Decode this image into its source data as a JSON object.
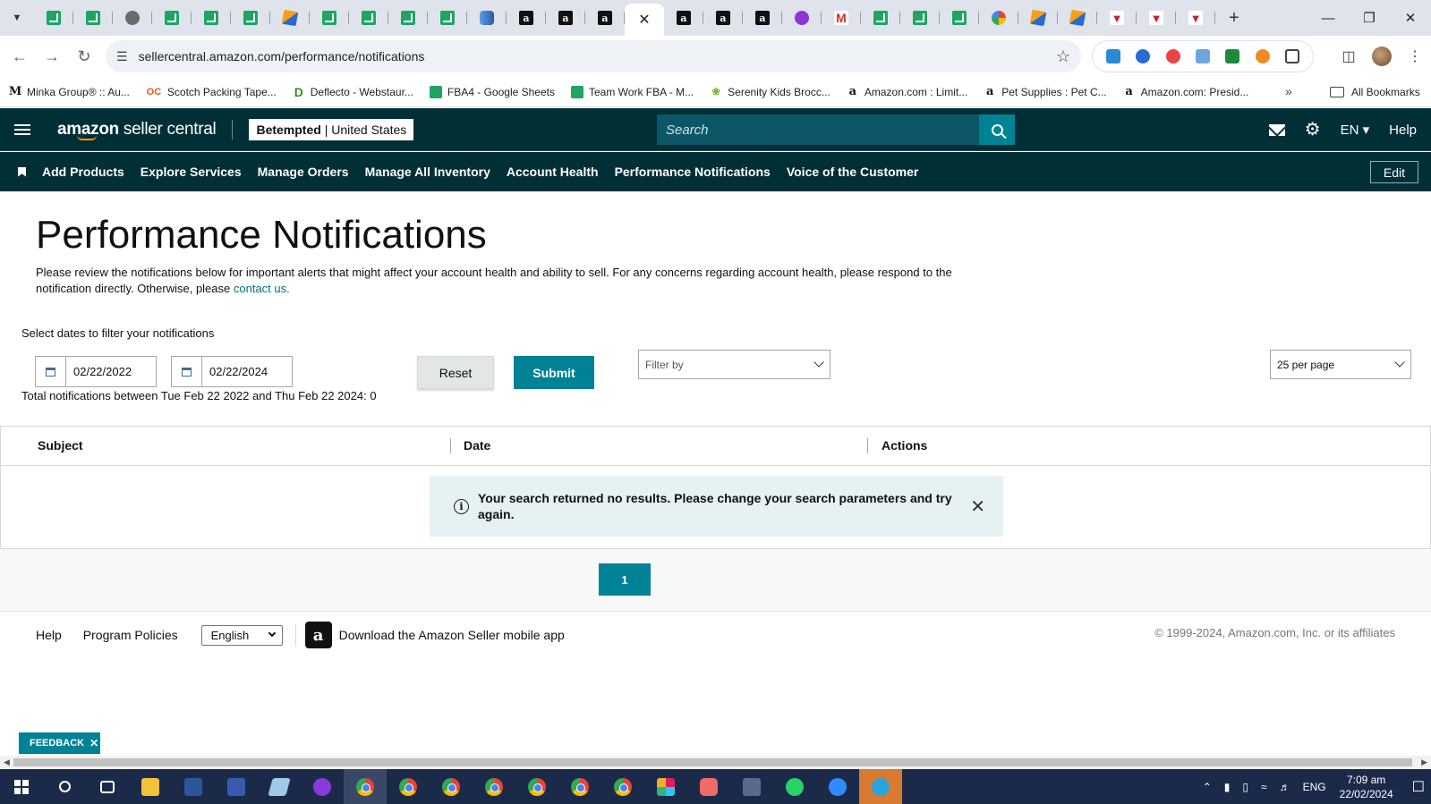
{
  "browser": {
    "address": "sellercentral.amazon.com/performance/notifications",
    "bookmarks": [
      {
        "label": "Minka Group® :: Au...",
        "icon": "M"
      },
      {
        "label": "Scotch Packing Tape...",
        "icon": "OC"
      },
      {
        "label": "Deflecto - Webstaur...",
        "icon": "D"
      },
      {
        "label": "FBA4 - Google Sheets",
        "icon": ""
      },
      {
        "label": "Team Work FBA - M...",
        "icon": ""
      },
      {
        "label": "Serenity Kids Brocc...",
        "icon": ""
      },
      {
        "label": "Amazon.com : Limit...",
        "icon": "a"
      },
      {
        "label": "Pet Supplies : Pet C...",
        "icon": "a"
      },
      {
        "label": "Amazon.com: Presid...",
        "icon": "a"
      }
    ],
    "all_bookmarks": "All Bookmarks",
    "more": "»"
  },
  "header": {
    "logo_bold": "amazon",
    "logo_rest": " seller central",
    "account_name": "Betempted",
    "account_region": " | United States",
    "search_placeholder": "Search",
    "language": "EN ▾",
    "help": "Help"
  },
  "nav": {
    "items": [
      "Add Products",
      "Explore Services",
      "Manage Orders",
      "Manage All Inventory",
      "Account Health",
      "Performance Notifications",
      "Voice of the Customer"
    ],
    "edit": "Edit"
  },
  "main": {
    "title": "Performance Notifications",
    "intro_text": "Please review the notifications below for important alerts that might affect your account health and ability to sell. For any concerns regarding account health, please respond to the notification directly. Otherwise, please ",
    "contact_link": "contact us.",
    "filter_label": "Select dates to filter your notifications",
    "date_from": "02/22/2022",
    "date_to": "02/22/2024",
    "reset": "Reset",
    "submit": "Submit",
    "filter_by": "Filter by",
    "per_page": "25 per page",
    "total": "Total notifications between Tue Feb 22 2022 and Thu Feb 22 2024: 0"
  },
  "table": {
    "columns": [
      "Subject",
      "Date",
      "Actions"
    ],
    "empty_message": "Your search returned no results. Please change your search parameters and try again."
  },
  "pagination": {
    "current": "1"
  },
  "footer": {
    "help": "Help",
    "policies": "Program Policies",
    "language": "English",
    "app": "Download the Amazon Seller mobile app",
    "copyright": "© 1999-2024, Amazon.com, Inc. or its affiliates"
  },
  "feedback": "FEEDBACK",
  "taskbar": {
    "lang": "ENG",
    "time": "7:09 am",
    "date": "22/02/2024"
  },
  "colors": {
    "header_bg": "#002f36",
    "accent": "#008296",
    "link": "#007185"
  }
}
